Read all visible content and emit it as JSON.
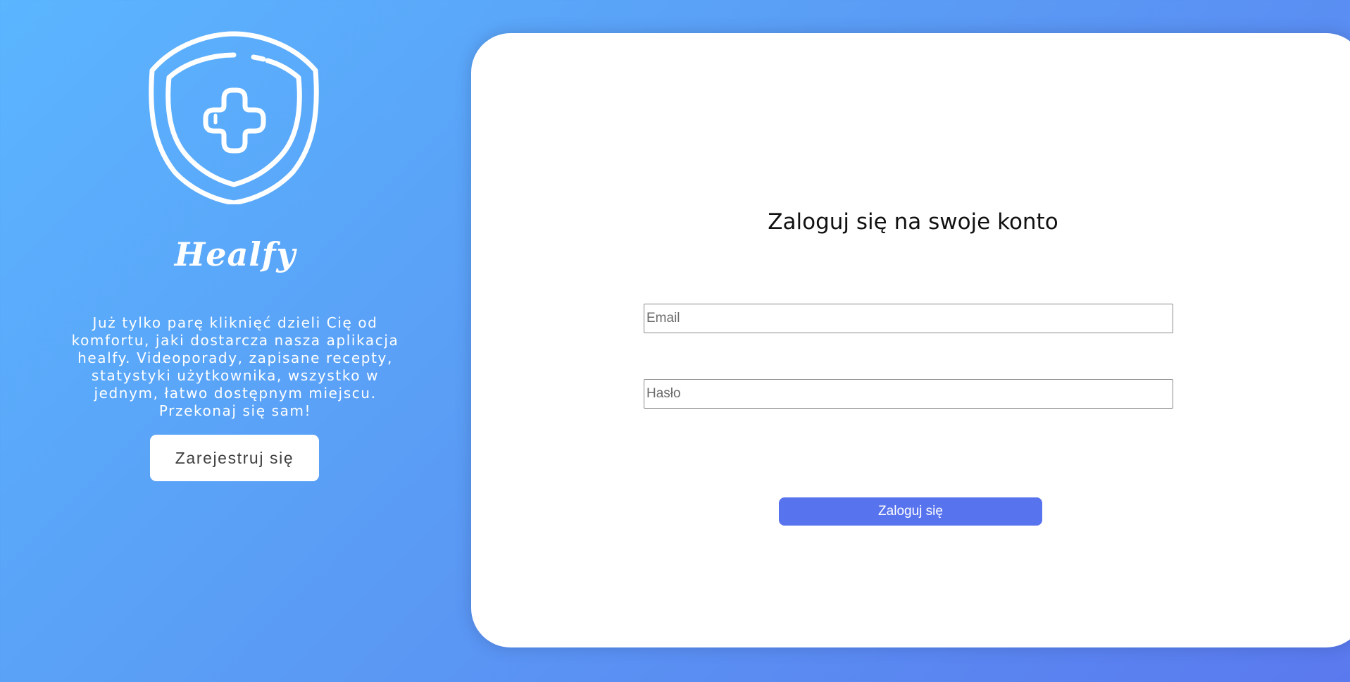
{
  "brand": {
    "name": "Healfy",
    "tagline": "Już tylko parę kliknięć dzieli Cię od komfortu, jaki dostarcza nasza aplikacja healfy. Videoporady, zapisane recepty, statystyki użytkownika, wszystko w jednym, łatwo dostępnym miejscu. Przekonaj się sam!",
    "logo_icon": "shield-medical-cross-icon"
  },
  "register": {
    "label": "Zarejestruj się"
  },
  "login_form": {
    "title": "Zaloguj się na swoje konto",
    "email_placeholder": "Email",
    "password_placeholder": "Hasło",
    "submit_label": "Zaloguj się"
  },
  "colors": {
    "gradient_start": "#5bb5ff",
    "gradient_end": "#5a79ee",
    "login_button": "#5873ee",
    "card_background": "#ffffff"
  }
}
